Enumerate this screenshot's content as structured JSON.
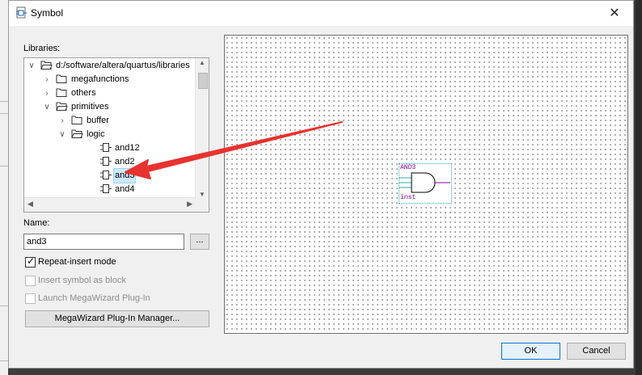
{
  "window": {
    "title": "Symbol",
    "close_glyph": "✕"
  },
  "libraries": {
    "label": "Libraries:",
    "tree": [
      {
        "label": "d:/software/altera/quartus/libraries",
        "expanded": true,
        "icon": "folder-open-icon"
      },
      {
        "label": "megafunctions",
        "expanded": false,
        "icon": "folder-icon"
      },
      {
        "label": "others",
        "expanded": false,
        "icon": "folder-icon"
      },
      {
        "label": "primitives",
        "expanded": true,
        "icon": "folder-open-icon"
      },
      {
        "label": "buffer",
        "expanded": false,
        "icon": "folder-icon"
      },
      {
        "label": "logic",
        "expanded": true,
        "icon": "folder-open-icon"
      },
      {
        "label": "and12",
        "icon": "gate-symbol-icon"
      },
      {
        "label": "and2",
        "icon": "gate-symbol-icon"
      },
      {
        "label": "and3",
        "icon": "gate-symbol-icon",
        "selected": true
      },
      {
        "label": "and4",
        "icon": "gate-symbol-icon"
      }
    ]
  },
  "name": {
    "label": "Name:",
    "value": "and3",
    "browse_label": "..."
  },
  "options": {
    "repeat_insert": {
      "label": "Repeat-insert mode",
      "checked": true,
      "enabled": true
    },
    "insert_as_block": {
      "label": "Insert symbol as block",
      "checked": false,
      "enabled": false
    },
    "launch_megawizard": {
      "label": "Launch MegaWizard Plug-In",
      "checked": false,
      "enabled": false
    }
  },
  "megawizard_button": "MegaWizard Plug-In Manager...",
  "preview": {
    "symbol_name": "AND3",
    "instance_name": "inst",
    "colors": {
      "frame": "#2aa8a8",
      "text": "#7b00a0",
      "gate": "#000000",
      "output_wire": "#7b00a0"
    }
  },
  "buttons": {
    "ok": "OK",
    "cancel": "Cancel"
  },
  "annotation_color": "#e8322f"
}
